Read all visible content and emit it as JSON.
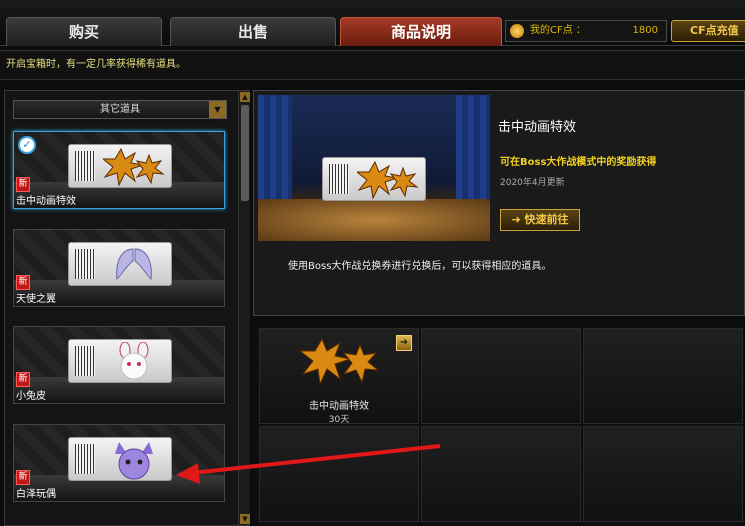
{
  "tabs": [
    {
      "label": "购买",
      "active": false
    },
    {
      "label": "出售",
      "active": false
    },
    {
      "label": "商品说明",
      "active": true
    }
  ],
  "account": {
    "cf_label": "我的CF点 ：",
    "cf_value": "1800",
    "recharge_label": "CF点充值"
  },
  "notice": "开启宝箱时，有一定几率获得稀有道具。",
  "category": {
    "selected": "其它道具"
  },
  "items": [
    {
      "name": "击中动画特效",
      "new_badge": "新",
      "selected": true
    },
    {
      "name": "天使之翼",
      "new_badge": "新",
      "selected": false
    },
    {
      "name": "小兔皮",
      "new_badge": "新",
      "selected": false
    },
    {
      "name": "白泽玩偶",
      "new_badge": "新",
      "selected": false
    }
  ],
  "detail": {
    "title": "击中动画特效",
    "source": "可在Boss大作战模式中的奖励获得",
    "date": "2020年4月更新",
    "goto_label": "➜ 快速前往",
    "description": "使用Boss大作战兑换券进行兑换后，可以获得相应的道具。"
  },
  "rewards": [
    {
      "name": "击中动画特效",
      "duration": "30天"
    }
  ],
  "colors": {
    "accent_gold": "#f3c84a",
    "tab_active": "#a53a25",
    "highlight_yellow": "#f1d11c",
    "arrow_red": "#e01818"
  }
}
